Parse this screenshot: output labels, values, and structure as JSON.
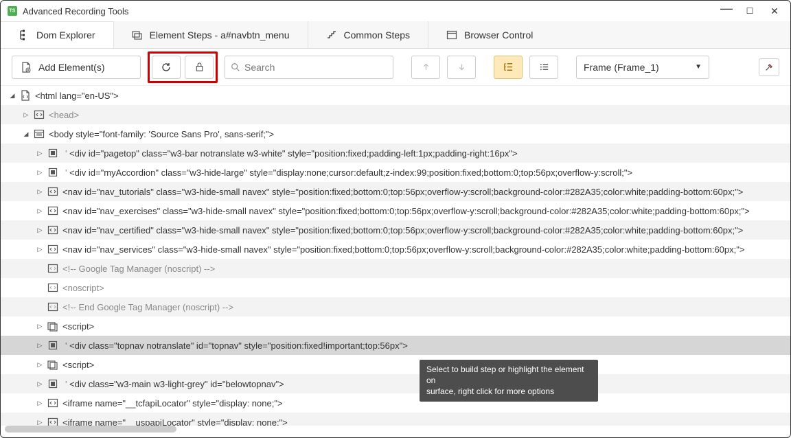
{
  "window": {
    "title": "Advanced Recording Tools"
  },
  "tabs": {
    "dom_explorer": "Dom Explorer",
    "element_steps": "Element Steps - a#navbtn_menu",
    "common_steps": "Common Steps",
    "browser_control": "Browser Control"
  },
  "toolbar": {
    "add_elements": "Add Element(s)",
    "search_placeholder": "Search",
    "frame_label": "Frame (Frame_1)"
  },
  "tree": {
    "n0": "<html lang=\"en-US\">",
    "n1": "<head>",
    "n2": "<body style=\"font-family: 'Source Sans Pro', sans-serif;\">",
    "n3": "<div id=\"pagetop\" class=\"w3-bar notranslate w3-white\" style=\"position:fixed;padding-left:1px;padding-right:16px\">",
    "n4": "<div id=\"myAccordion\" class=\"w3-hide-large\" style=\"display:none;cursor:default;z-index:99;position:fixed;bottom:0;top:56px;overflow-y:scroll;\">",
    "n5": "<nav id=\"nav_tutorials\" class=\"w3-hide-small navex\" style=\"position:fixed;bottom:0;top:56px;overflow-y:scroll;background-color:#282A35;color:white;padding-bottom:60px;\">",
    "n6": "<nav id=\"nav_exercises\" class=\"w3-hide-small navex\" style=\"position:fixed;bottom:0;top:56px;overflow-y:scroll;background-color:#282A35;color:white;padding-bottom:60px;\">",
    "n7": "<nav id=\"nav_certified\" class=\"w3-hide-small navex\" style=\"position:fixed;bottom:0;top:56px;overflow-y:scroll;background-color:#282A35;color:white;padding-bottom:60px;\">",
    "n8": "<nav id=\"nav_services\" class=\"w3-hide-small navex\" style=\"position:fixed;bottom:0;top:56px;overflow-y:scroll;background-color:#282A35;color:white;padding-bottom:60px;\">",
    "n9": "<!-- Google Tag Manager (noscript) -->",
    "n10": "<noscript>",
    "n11": "<!-- End Google Tag Manager (noscript) -->",
    "n12": "<script>",
    "n13": "<div class=\"topnav notranslate\" id=\"topnav\" style=\"position:fixed!important;top:56px\">",
    "n14": "<script>",
    "n15": "<div class=\"w3-main w3-light-grey\" id=\"belowtopnav\">",
    "n16": "<iframe name=\"__tcfapiLocator\" style=\"display: none;\">",
    "n17": "<iframe name=\"__uspapiLocator\" style=\"display: none;\">"
  },
  "tooltip": {
    "line1": "Select to build step or highlight the element on",
    "line2": "surface, right click for more options"
  }
}
